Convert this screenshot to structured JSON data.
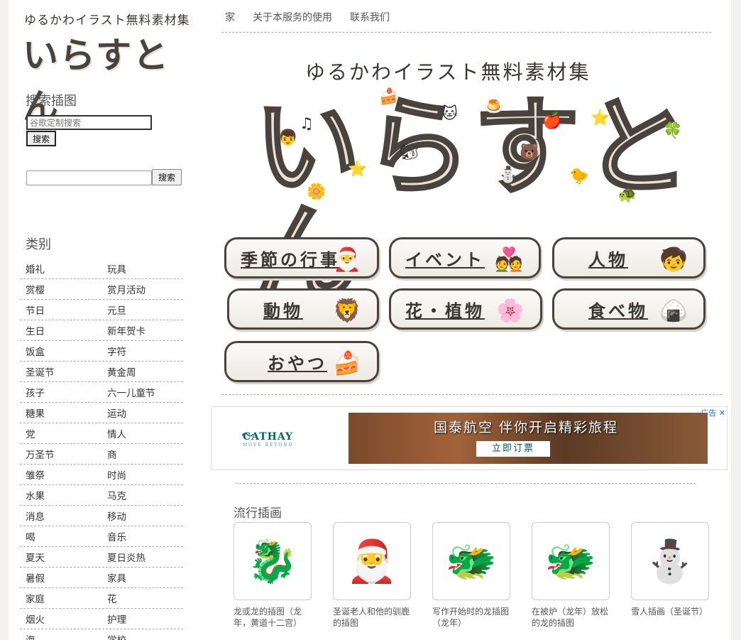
{
  "logo": {
    "subtitle": "ゆるかわイラスト無料素材集",
    "title": "いらすとん"
  },
  "sidebar": {
    "search_heading": "搜索插图",
    "search_placeholder": "谷歌定制搜索",
    "search_button": "搜索",
    "search_button2": "搜索",
    "category_heading": "类别",
    "categories": [
      [
        "婚礼",
        "玩具"
      ],
      [
        "赏樱",
        "赏月活动"
      ],
      [
        "节日",
        "元旦"
      ],
      [
        "生日",
        "新年贺卡"
      ],
      [
        "饭盒",
        "字符"
      ],
      [
        "圣诞节",
        "黄金周"
      ],
      [
        "孩子",
        "六一儿童节"
      ],
      [
        "糖果",
        "运动"
      ],
      [
        "党",
        "情人"
      ],
      [
        "万圣节",
        "商"
      ],
      [
        "雏祭",
        "时尚"
      ],
      [
        "水果",
        "马克"
      ],
      [
        "消息",
        "移动"
      ],
      [
        "喝",
        "音乐"
      ],
      [
        "夏天",
        "夏日炎热"
      ],
      [
        "暑假",
        "家具"
      ],
      [
        "家庭",
        "花"
      ],
      [
        "烟火",
        "护理"
      ],
      [
        "海",
        "学校"
      ]
    ]
  },
  "nav": {
    "items": [
      "家",
      "关于本服务的使用",
      "联系我们"
    ]
  },
  "hero": {
    "subtitle": "ゆるかわイラスト無料素材集",
    "title": "いらすとん"
  },
  "category_buttons": [
    {
      "label": "季節の行事",
      "icon": "santa-icon"
    },
    {
      "label": "イベント",
      "icon": "wedding-couple-icon"
    },
    {
      "label": "人物",
      "icon": "person-icon"
    },
    {
      "label": "動物",
      "icon": "lion-icon"
    },
    {
      "label": "花・植物",
      "icon": "flower-icon"
    },
    {
      "label": "食べ物",
      "icon": "onigiri-icon"
    },
    {
      "label": "おやつ",
      "icon": "cake-icon"
    }
  ],
  "ad": {
    "brand": "CATHAY",
    "tagline": "MOVE BEYOND",
    "headline": "国泰航空 伴你开启精彩旅程",
    "cta": "立即订票",
    "choices_label": "广告"
  },
  "popular": {
    "heading": "流行插画",
    "items": [
      {
        "caption": "龙或龙的插图（龙年，黄道十二宫）",
        "icon": "dragon-icon"
      },
      {
        "caption": "圣诞老人和他的驯鹿的插图",
        "icon": "santa-reindeer-icon"
      },
      {
        "caption": "写作开始时的龙插图（龙年）",
        "icon": "dragon-writing-icon"
      },
      {
        "caption": "在被炉（龙年）放松的龙的插图",
        "icon": "dragon-kotatsu-icon"
      },
      {
        "caption": "雪人插画（圣诞节）",
        "icon": "snowman-icon"
      }
    ]
  }
}
